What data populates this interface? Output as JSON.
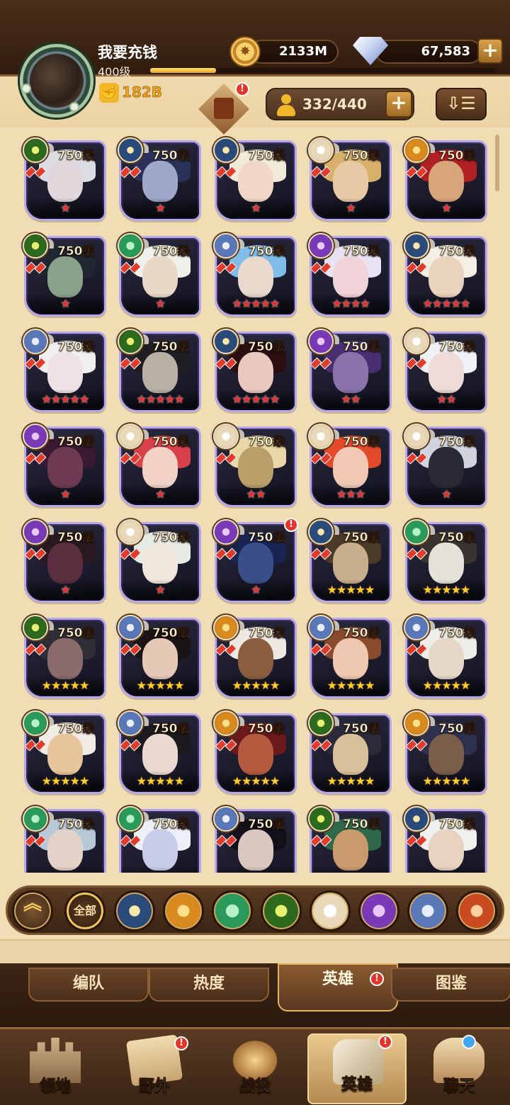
{
  "player": {
    "name": "我要充钱",
    "level": "400级",
    "xp_fraction": 0.19,
    "power": "182B"
  },
  "resources": {
    "gold": "2133M",
    "diamonds": "67,583",
    "roster": "332/440"
  },
  "heroes": [
    {
      "level": "750级",
      "faction": "forest",
      "stars": "★",
      "star_color": "red",
      "face": "#e0d6dc",
      "hair": "#dcdde2"
    },
    {
      "level": "750级",
      "faction": "light",
      "stars": "★",
      "star_color": "red",
      "face": "#9ea8c8",
      "hair": "#2a3158"
    },
    {
      "level": "750级",
      "faction": "light",
      "stars": "★",
      "star_color": "red",
      "face": "#f2d7c6",
      "hair": "#f1ead8"
    },
    {
      "level": "750级",
      "faction": "celestial",
      "stars": "★",
      "star_color": "red",
      "face": "#e8c9a6",
      "hair": "#d7b06a"
    },
    {
      "level": "750级",
      "faction": "fire",
      "stars": "★",
      "star_color": "red",
      "face": "#d8a57a",
      "hair": "#b01f22"
    },
    {
      "level": "750级",
      "faction": "forest",
      "stars": "★",
      "star_color": "red",
      "face": "#8aa28a",
      "hair": "#1f2630"
    },
    {
      "level": "750级",
      "faction": "nature",
      "stars": "★",
      "star_color": "red",
      "face": "#e8d8c6",
      "hair": "#eef0ea"
    },
    {
      "level": "750级",
      "faction": "blue",
      "stars": "★★★★★",
      "star_color": "red",
      "face": "#e9d8cc",
      "hair": "#7fbde8"
    },
    {
      "level": "750级",
      "faction": "void",
      "stars": "★★★★",
      "star_color": "red",
      "face": "#f0d3d9",
      "hair": "#e9e2f2"
    },
    {
      "level": "750级",
      "faction": "light",
      "stars": "★★★★★",
      "star_color": "red",
      "face": "#e9d2be",
      "hair": "#f3efe4"
    },
    {
      "level": "750级",
      "faction": "blue",
      "stars": "★★★★★",
      "star_color": "red",
      "face": "#efe2e4",
      "hair": "#f0eeee"
    },
    {
      "level": "750级",
      "faction": "forest",
      "stars": "★★★★★",
      "star_color": "red",
      "face": "#b8b0a4",
      "hair": "#1e1e22"
    },
    {
      "level": "750级",
      "faction": "light",
      "stars": "★★★★★",
      "star_color": "red",
      "face": "#e9c8c0",
      "hair": "#2a0e10"
    },
    {
      "level": "750级",
      "faction": "void",
      "stars": "★★",
      "star_color": "red",
      "face": "#8a72aa",
      "hair": "#4a2e72"
    },
    {
      "level": "750级",
      "faction": "celestial",
      "stars": "★★",
      "star_color": "red",
      "face": "#eedad6",
      "hair": "#eef1f6"
    },
    {
      "level": "750级",
      "faction": "void",
      "stars": "★",
      "star_color": "red",
      "face": "#6d3a52",
      "hair": "#3a1a30"
    },
    {
      "level": "750级",
      "faction": "celestial",
      "stars": "★",
      "star_color": "red",
      "face": "#f2d2c4",
      "hair": "#d9414a"
    },
    {
      "level": "750级",
      "faction": "celestial",
      "stars": "★★",
      "star_color": "red",
      "face": "#b9a068",
      "hair": "#e8d8a8"
    },
    {
      "level": "750级",
      "faction": "celestial",
      "stars": "★★★",
      "star_color": "red",
      "face": "#f0c8b4",
      "hair": "#e24a2a"
    },
    {
      "level": "750级",
      "faction": "celestial",
      "stars": "★",
      "star_color": "red",
      "face": "#2a2a34",
      "hair": "#cfd4de"
    },
    {
      "level": "750级",
      "faction": "void",
      "stars": "★",
      "star_color": "red",
      "face": "#5a2e3e",
      "hair": "#2a1820"
    },
    {
      "level": "750级",
      "faction": "celestial",
      "stars": "★",
      "star_color": "red",
      "face": "#f0e6dc",
      "hair": "#e6eae4"
    },
    {
      "level": "750级",
      "faction": "void",
      "stars": "★",
      "star_color": "red",
      "face": "#3a4e8a",
      "hair": "#1a2450"
    },
    {
      "level": "750级",
      "faction": "light",
      "stars": "★★★★★",
      "star_color": "gold",
      "face": "#c8ae8c",
      "hair": "#4a3a28"
    },
    {
      "level": "750级",
      "faction": "nature",
      "stars": "★★★★★",
      "star_color": "gold",
      "face": "#e6e2da",
      "hair": "#3a3430"
    },
    {
      "level": "750级",
      "faction": "forest",
      "stars": "★★★★★",
      "star_color": "gold",
      "face": "#8a6a6a",
      "hair": "#2e2e34"
    },
    {
      "level": "750级",
      "faction": "blue",
      "stars": "★★★★★",
      "star_color": "gold",
      "face": "#e6c8b6",
      "hair": "#1a1414"
    },
    {
      "level": "750级",
      "faction": "fire",
      "stars": "★★★★★",
      "star_color": "gold",
      "face": "#8a5e3e",
      "hair": "#eee8e2"
    },
    {
      "level": "750级",
      "faction": "blue",
      "stars": "★★★★★",
      "star_color": "gold",
      "face": "#eec8b0",
      "hair": "#8a4a2e"
    },
    {
      "level": "750级",
      "faction": "blue",
      "stars": "★★★★★",
      "star_color": "gold",
      "face": "#e6d8c8",
      "hair": "#efede8"
    },
    {
      "level": "750级",
      "faction": "nature",
      "stars": "★★★★★",
      "star_color": "gold",
      "face": "#e8c49a",
      "hair": "#f0ece4"
    },
    {
      "level": "750级",
      "faction": "blue",
      "stars": "★★★★★",
      "star_color": "gold",
      "face": "#e8d8d0",
      "hair": "#1c1a1e"
    },
    {
      "level": "750级",
      "faction": "fire",
      "stars": "★★★★★",
      "star_color": "gold",
      "face": "#b45a3e",
      "hair": "#6a1a1a"
    },
    {
      "level": "750级",
      "faction": "forest",
      "stars": "★★★★★",
      "star_color": "gold",
      "face": "#d8c09a",
      "hair": "#2a2a3a"
    },
    {
      "level": "750级",
      "faction": "fire",
      "stars": "★★★★★",
      "star_color": "gold",
      "face": "#7a5e4a",
      "hair": "#2e3050"
    },
    {
      "level": "750级",
      "faction": "nature",
      "stars": "",
      "star_color": "red",
      "face": "#e4d2c8",
      "hair": "#b8c8d8"
    },
    {
      "level": "750级",
      "faction": "nature",
      "stars": "",
      "star_color": "red",
      "face": "#c8cce8",
      "hair": "#eef0f8"
    },
    {
      "level": "750级",
      "faction": "blue",
      "stars": "",
      "star_color": "red",
      "face": "#d8c8c0",
      "hair": "#14101a"
    },
    {
      "level": "750级",
      "faction": "forest",
      "stars": "",
      "star_color": "red",
      "face": "#c89a6e",
      "hair": "#2e6a4a"
    },
    {
      "level": "750级",
      "faction": "light",
      "stars": "",
      "star_color": "red",
      "face": "#e8d2c0",
      "hair": "#f0f0ee"
    }
  ],
  "filters": {
    "collapse_icon": "double-chevron-up-icon",
    "all_label": "全部",
    "factions": [
      "light",
      "celestial-gold",
      "nature",
      "forest",
      "celestial",
      "void",
      "blue",
      "fire"
    ]
  },
  "sub_tabs": [
    "编队",
    "热度",
    "英雄",
    "图鉴"
  ],
  "bottom_nav": [
    "领地",
    "野外",
    "战役",
    "英雄",
    "聊天"
  ],
  "colors": {
    "accent_gold": "#f2b629",
    "badge_red": "#e3362a",
    "card_border": "#b7a8e6"
  }
}
